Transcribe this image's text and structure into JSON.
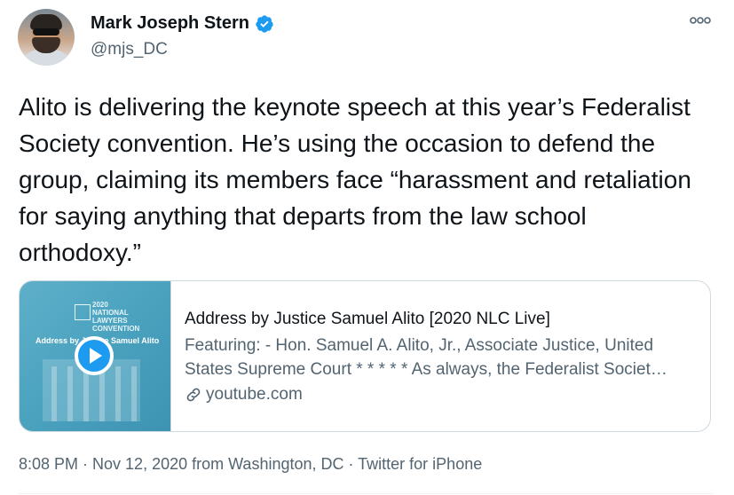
{
  "author": {
    "name": "Mark Joseph Stern",
    "handle": "@mjs_DC",
    "verified_icon": "verified-badge-icon"
  },
  "tweet": {
    "text": "Alito is delivering the keynote speech at this year’s Federalist Society convention. He’s using the occasion to defend the group, claiming its members face “harassment and retaliation for saying anything that departs from the law school orthodoxy.”"
  },
  "card": {
    "title": "Address by Justice Samuel Alito [2020 NLC Live]",
    "description_line1": "Featuring: - Hon. Samuel A. Alito, Jr., Associate Justice, United",
    "description_line2": "States Supreme Court * * * * * As always, the Federalist Societ…",
    "domain": "youtube.com",
    "thumbnail": {
      "caption": "Address by Justice Samuel Alito",
      "logo_text": "2020 NATIONAL LAWYERS CONVENTION"
    }
  },
  "meta": {
    "timestamp": "8:08 PM · Nov 12, 2020 from Washington, DC · Twitter for iPhone"
  },
  "colors": {
    "text": "#0f1419",
    "secondary": "#536471",
    "accent": "#1d9bf0",
    "border": "#cfd9de"
  }
}
